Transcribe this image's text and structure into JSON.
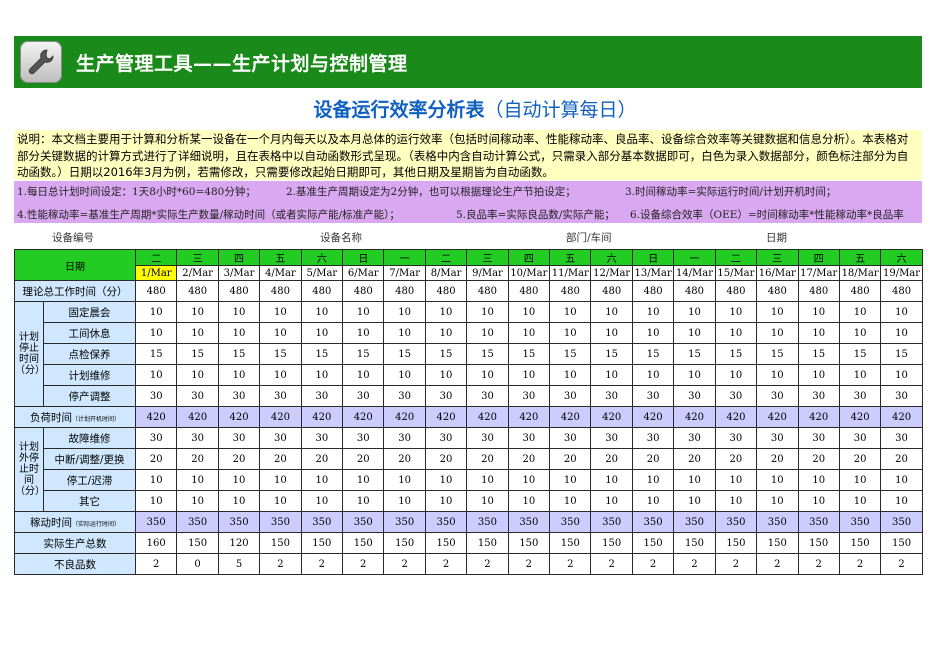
{
  "banner": {
    "title": "生产管理工具——生产计划与控制管理",
    "icon": "wrench-icon"
  },
  "doc_title": {
    "main": "设备运行效率分析表",
    "sub": "（自动计算每日）"
  },
  "description": "说明：本文档主要用于计算和分析某一设备在一个月内每天以及本月总体的运行效率（包括时间稼动率、性能稼动率、良品率、设备综合效率等关键数据和信息分析）。本表格对部分关键数据的计算方式进行了详细说明，且在表格中以自动函数形式呈现。（表格中内含自动计算公式，只需录入部分基本数据即可，白色为录入数据部分，颜色标注部分为自动函数。）日期以2016年3月为例，若需修改，只需要修改起始日期即可，其他日期及星期皆为自动函数。",
  "notes": {
    "n1": "1.每日总计划时间设定：1天8小时*60=480分钟；",
    "n2": "2.基准生产周期设定为2分钟，也可以根据理论生产节拍设定；",
    "n3": "3.时间稼动率=实际运行时间/计划开机时间；",
    "n4": "4.性能稼动率=基准生产周期*实际生产数量/稼动时间（或者实际产能/标准产能）；",
    "n5": "5.良品率=实际良品数/实际产能；",
    "n6": "6.设备综合效率（OEE）=时间稼动率*性能稼动率*良品率"
  },
  "meta": {
    "equipment_no": "设备编号",
    "equipment_name": "设备名称",
    "department": "部门/车间",
    "date": "日期"
  },
  "table": {
    "date_header": "日期",
    "weekdays": [
      "二",
      "三",
      "四",
      "五",
      "六",
      "日",
      "一",
      "二",
      "三",
      "四",
      "五",
      "六",
      "日",
      "一",
      "二",
      "三",
      "四",
      "五",
      "六"
    ],
    "dates": [
      "1/Mar",
      "2/Mar",
      "3/Mar",
      "4/Mar",
      "5/Mar",
      "6/Mar",
      "7/Mar",
      "8/Mar",
      "9/Mar",
      "10/Mar",
      "11/Mar",
      "12/Mar",
      "13/Mar",
      "14/Mar",
      "15/Mar",
      "16/Mar",
      "17/Mar",
      "18/Mar",
      "19/Mar"
    ],
    "theory_label": "理论总工作时间（分）",
    "theory": [
      480,
      480,
      480,
      480,
      480,
      480,
      480,
      480,
      480,
      480,
      480,
      480,
      480,
      480,
      480,
      480,
      480,
      480,
      480
    ],
    "planned_stop_group": "计划停止时间（分）",
    "planned_stop": [
      {
        "label": "固定晨会",
        "values": [
          10,
          10,
          10,
          10,
          10,
          10,
          10,
          10,
          10,
          10,
          10,
          10,
          10,
          10,
          10,
          10,
          10,
          10,
          10
        ]
      },
      {
        "label": "工间休息",
        "values": [
          10,
          10,
          10,
          10,
          10,
          10,
          10,
          10,
          10,
          10,
          10,
          10,
          10,
          10,
          10,
          10,
          10,
          10,
          10
        ]
      },
      {
        "label": "点检保养",
        "values": [
          15,
          15,
          15,
          15,
          15,
          15,
          15,
          15,
          15,
          15,
          15,
          15,
          15,
          15,
          15,
          15,
          15,
          15,
          15
        ]
      },
      {
        "label": "计划维修",
        "values": [
          10,
          10,
          10,
          10,
          10,
          10,
          10,
          10,
          10,
          10,
          10,
          10,
          10,
          10,
          10,
          10,
          10,
          10,
          10
        ]
      },
      {
        "label": "停产调整",
        "values": [
          30,
          30,
          30,
          30,
          30,
          30,
          30,
          30,
          30,
          30,
          30,
          30,
          30,
          30,
          30,
          30,
          30,
          30,
          30
        ]
      }
    ],
    "load_label": "负荷时间",
    "load_note": "（计划开机时间）",
    "load": [
      420,
      420,
      420,
      420,
      420,
      420,
      420,
      420,
      420,
      420,
      420,
      420,
      420,
      420,
      420,
      420,
      420,
      420,
      420
    ],
    "unplanned_stop_group": "计划外停止时间（分）",
    "unplanned_stop": [
      {
        "label": "故障维修",
        "values": [
          30,
          30,
          30,
          30,
          30,
          30,
          30,
          30,
          30,
          30,
          30,
          30,
          30,
          30,
          30,
          30,
          30,
          30,
          30
        ]
      },
      {
        "label": "中断/调整/更换",
        "values": [
          20,
          20,
          20,
          20,
          20,
          20,
          20,
          20,
          20,
          20,
          20,
          20,
          20,
          20,
          20,
          20,
          20,
          20,
          20
        ]
      },
      {
        "label": "停工/迟滞",
        "values": [
          10,
          10,
          10,
          10,
          10,
          10,
          10,
          10,
          10,
          10,
          10,
          10,
          10,
          10,
          10,
          10,
          10,
          10,
          10
        ]
      },
      {
        "label": "其它",
        "values": [
          10,
          10,
          10,
          10,
          10,
          10,
          10,
          10,
          10,
          10,
          10,
          10,
          10,
          10,
          10,
          10,
          10,
          10,
          10
        ]
      }
    ],
    "run_label": "稼动时间",
    "run_note": "（实际运行时间）",
    "run": [
      350,
      350,
      350,
      350,
      350,
      350,
      350,
      350,
      350,
      350,
      350,
      350,
      350,
      350,
      350,
      350,
      350,
      350,
      350
    ],
    "output_label": "实际生产总数",
    "output": [
      160,
      150,
      120,
      150,
      150,
      150,
      150,
      150,
      150,
      150,
      150,
      150,
      150,
      150,
      150,
      150,
      150,
      150,
      150
    ],
    "defect_label": "不良品数",
    "defect": [
      2,
      0,
      5,
      2,
      2,
      2,
      2,
      2,
      2,
      2,
      2,
      2,
      2,
      2,
      2,
      2,
      2,
      2,
      2
    ]
  }
}
